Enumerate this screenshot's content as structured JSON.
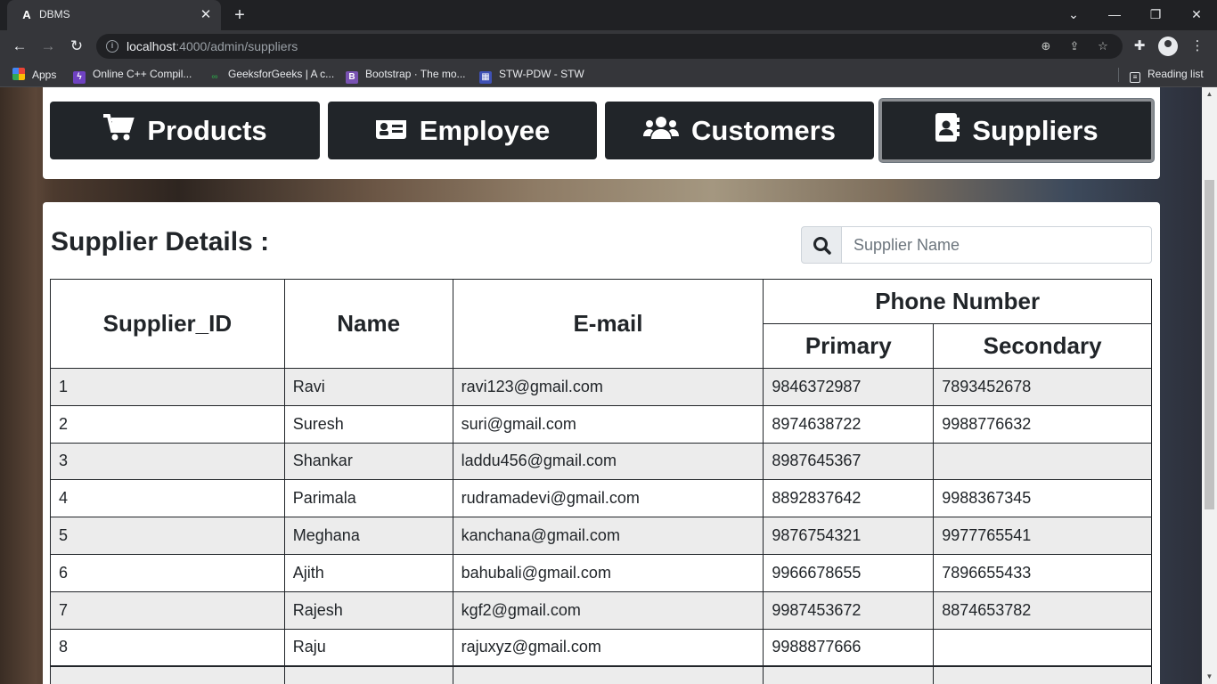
{
  "browser": {
    "tab_title": "DBMS",
    "url_host": "localhost",
    "url_path": ":4000/admin/suppliers",
    "bookmarks": [
      {
        "label": "Apps",
        "icon": "apps-grid-icon"
      },
      {
        "label": "Online C++ Compil...",
        "icon": "lightning-icon"
      },
      {
        "label": "GeeksforGeeks | A c...",
        "icon": "gfg-icon"
      },
      {
        "label": "Bootstrap · The mo...",
        "icon": "bootstrap-icon"
      },
      {
        "label": "STW-PDW - STW",
        "icon": "stw-icon"
      }
    ],
    "reading_list": "Reading list"
  },
  "nav": {
    "buttons": [
      {
        "label": "Products",
        "icon": "cart-icon"
      },
      {
        "label": "Employee",
        "icon": "id-card-icon"
      },
      {
        "label": "Customers",
        "icon": "users-icon"
      },
      {
        "label": "Suppliers",
        "icon": "address-book-icon",
        "active": true
      }
    ]
  },
  "section": {
    "title": "Supplier Details :",
    "search_placeholder": "Supplier Name"
  },
  "table": {
    "headers": {
      "id": "Supplier_ID",
      "name": "Name",
      "email": "E-mail",
      "phone": "Phone Number",
      "primary": "Primary",
      "secondary": "Secondary"
    },
    "rows": [
      {
        "id": "1",
        "name": "Ravi",
        "email": "ravi123@gmail.com",
        "primary": "9846372987",
        "secondary": "7893452678"
      },
      {
        "id": "2",
        "name": "Suresh",
        "email": "suri@gmail.com",
        "primary": "8974638722",
        "secondary": "9988776632"
      },
      {
        "id": "3",
        "name": "Shankar",
        "email": "laddu456@gmail.com",
        "primary": "8987645367",
        "secondary": ""
      },
      {
        "id": "4",
        "name": "Parimala",
        "email": "rudramadevi@gmail.com",
        "primary": "8892837642",
        "secondary": "9988367345"
      },
      {
        "id": "5",
        "name": "Meghana",
        "email": "kanchana@gmail.com",
        "primary": "9876754321",
        "secondary": "9977765541"
      },
      {
        "id": "6",
        "name": "Ajith",
        "email": "bahubali@gmail.com",
        "primary": "9966678655",
        "secondary": "7896655433"
      },
      {
        "id": "7",
        "name": "Rajesh",
        "email": "kgf2@gmail.com",
        "primary": "9987453672",
        "secondary": "8874653782"
      },
      {
        "id": "8",
        "name": "Raju",
        "email": "rajuxyz@gmail.com",
        "primary": "9988877666",
        "secondary": ""
      }
    ]
  }
}
